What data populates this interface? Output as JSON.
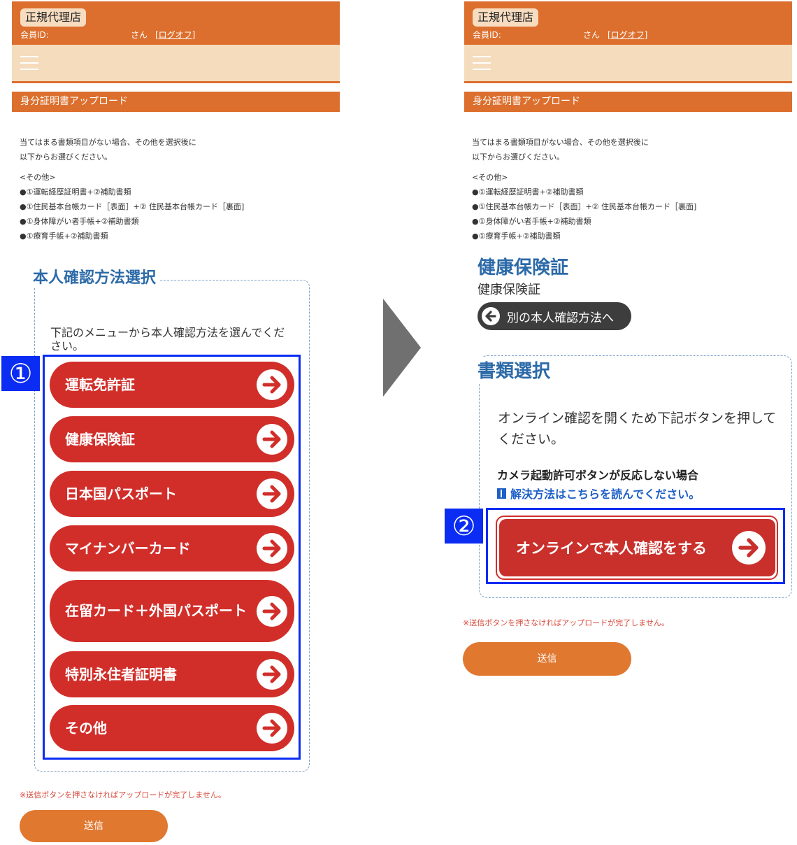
{
  "header": {
    "badge": "正規代理店",
    "member_id_label": "会員ID:",
    "san": "さん",
    "logout": "[ログオフ]"
  },
  "section_title": "身分証明書アップロード",
  "notes": {
    "line1": "当てはまる書類項目がない場合、その他を選択後に",
    "line2": "以下からお選びください。",
    "other_heading": "<その他>",
    "items": [
      "●①運転経歴証明書+②補助書類",
      "●①住民基本台帳カード［表面］+② 住民基本台帳カード［裏面]",
      "●①身体障がい者手帳+②補助書類",
      "●①療育手帳+②補助書類"
    ]
  },
  "left": {
    "method_title": "本人確認方法選択",
    "instruction": "下記のメニューから本人確認方法を選んでください。",
    "marker": "①",
    "buttons": [
      "運転免許証",
      "健康保険証",
      "日本国パスポート",
      "マイナンバーカード",
      "在留カード＋外国パスポート",
      "特別永住者証明書",
      "その他"
    ],
    "warning": "※送信ボタンを押さなければアップロードが完了しません。",
    "send": "送信"
  },
  "right": {
    "selected_title": "健康保険証",
    "selected_sub": "健康保険証",
    "back_button": "別の本人確認方法へ",
    "doc_title": "書類選択",
    "doc_instruction": "オンライン確認を開くため下記ボタンを押してください。",
    "camera_warning": "カメラ起動許可ボタンが反応しない場合",
    "solution_link": "解決方法はこちらを読んでください。",
    "marker": "②",
    "online_button": "オンラインで本人確認をする",
    "warning": "※送信ボタンを押さなければアップロードが完了しません。",
    "send": "送信"
  },
  "colors": {
    "header_orange": "#dc6f2d",
    "nav_beige": "#f5dcbd",
    "button_red": "#d12e2a",
    "title_blue": "#2c6aa8",
    "highlight_blue": "#0b2cf2"
  }
}
